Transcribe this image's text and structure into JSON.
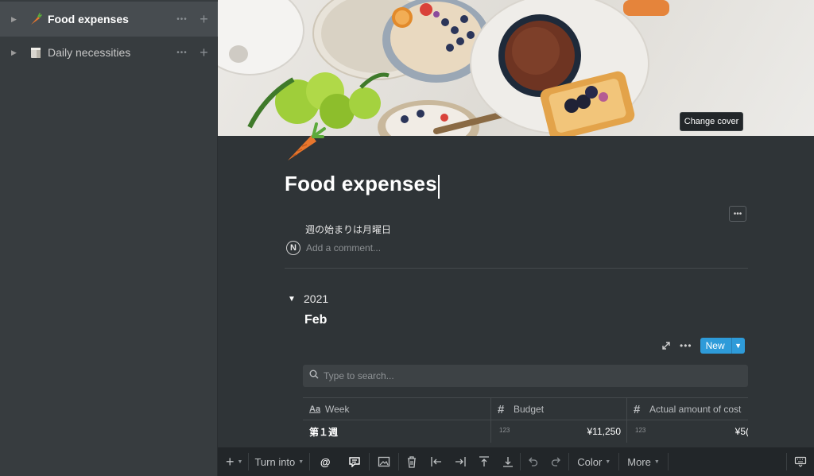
{
  "sidebar": {
    "items": [
      {
        "label": "Food expenses",
        "icon": "carrot-icon",
        "active": true
      },
      {
        "label": "Daily necessities",
        "icon": "package-icon",
        "active": false
      }
    ],
    "more_glyph": "•••",
    "add_glyph": "+"
  },
  "page": {
    "change_cover_label": "Change cover",
    "title": "Food expenses",
    "more_glyph": "•••",
    "property_note": "週の始まりは月曜日",
    "comment_avatar": "N",
    "comment_placeholder": "Add a comment..."
  },
  "toggle": {
    "label": "2021"
  },
  "heading": "Feb",
  "database": {
    "more_glyph": "•••",
    "new_label": "New",
    "search_placeholder": "Type to search...",
    "columns": [
      {
        "icon": "Aa",
        "label": "Week"
      },
      {
        "icon": "#",
        "label": "Budget"
      },
      {
        "icon": "#",
        "label": "Actual amount of cost"
      }
    ],
    "rows": [
      {
        "week": "第１週",
        "budget_badge": "123",
        "budget": "¥11,250",
        "actual_badge": "123",
        "actual": "¥5("
      }
    ]
  },
  "toolbar": {
    "add_glyph": "+",
    "turn_into_label": "Turn into",
    "mention_glyph": "@",
    "color_label": "Color",
    "more_label": "More"
  },
  "colors": {
    "accent": "#2e9bd9",
    "background": "#2f3437",
    "sidebar": "#373c3f",
    "toolbar": "#222629"
  }
}
